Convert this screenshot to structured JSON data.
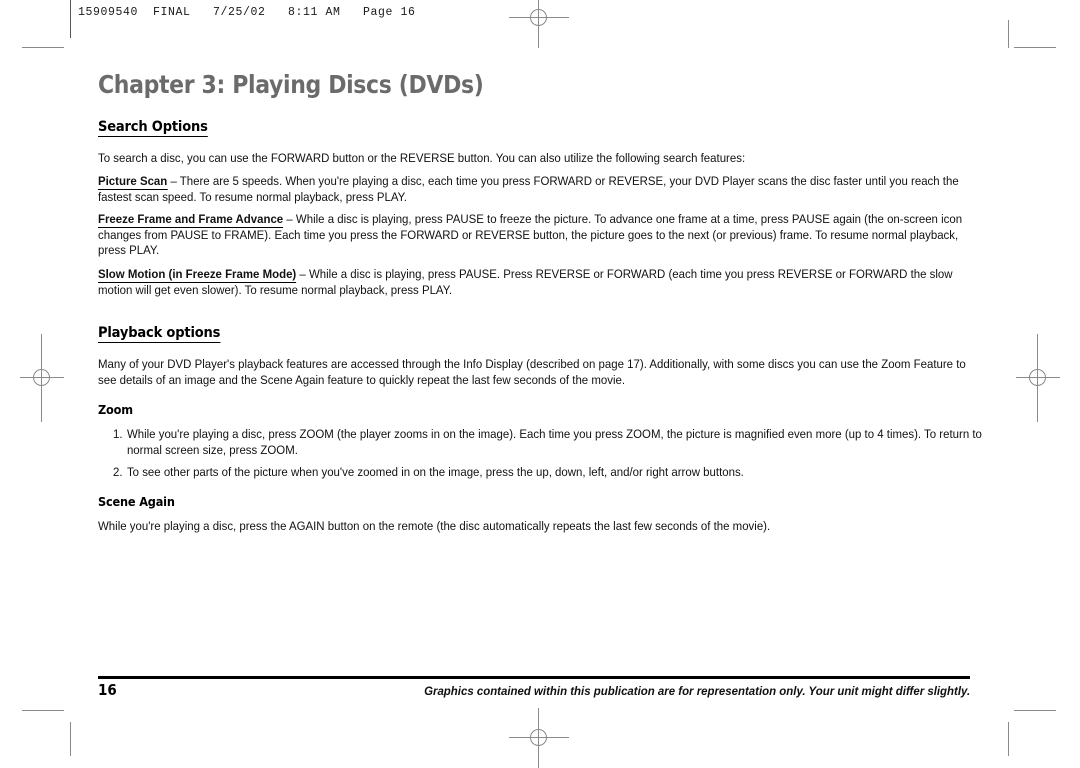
{
  "print_marks": {
    "header_slug": "15909540  FINAL   7/25/02   8:11 AM   Page 16",
    "registration_icon": "registration-target-icon"
  },
  "chapter": {
    "title": "Chapter 3: Playing Discs (DVDs)"
  },
  "sections": {
    "search_options": {
      "heading": "Search Options",
      "intro": "To search a disc, you can use the FORWARD button or the REVERSE button. You can also utilize the following search features:",
      "entries": [
        {
          "term": "Picture Scan",
          "dash": " – ",
          "body": "There are 5 speeds. When you're playing a disc, each time you press FORWARD or REVERSE, your DVD Player scans the disc faster until you reach the fastest scan speed. To resume normal playback, press PLAY."
        },
        {
          "term": "Freeze Frame and Frame Advance",
          "dash": " – ",
          "body": "While a disc is playing, press PAUSE to freeze the picture. To advance one frame at a time, press PAUSE again (the on-screen icon changes from PAUSE to FRAME). Each time you press the FORWARD or REVERSE button, the picture goes to the next (or previous) frame. To resume normal playback, press PLAY."
        },
        {
          "term": "Slow Motion (in Freeze Frame Mode)",
          "dash": " – ",
          "body": "While a disc is playing, press PAUSE. Press REVERSE or FORWARD (each time you press REVERSE or FORWARD the slow motion will get even slower). To resume normal playback, press PLAY."
        }
      ]
    },
    "playback_options": {
      "heading": "Playback options",
      "intro": "Many of your DVD Player's playback features are accessed through the Info Display (described on page 17). Additionally, with some discs you can use the Zoom Feature to see details of an image and the Scene Again feature to quickly repeat the last few seconds of the movie.",
      "zoom": {
        "heading": "Zoom",
        "steps": [
          {
            "number": "1.",
            "text": "While you're playing a disc, press ZOOM (the player zooms in on the image). Each time you press ZOOM, the picture is magnified even more (up to 4 times). To return to normal screen size, press ZOOM."
          },
          {
            "number": "2.",
            "text": "To see other parts of the picture when you've zoomed in on the image, press the up, down, left, and/or right arrow buttons."
          }
        ]
      },
      "scene_again": {
        "heading": "Scene Again",
        "body": "While you're playing a disc, press the AGAIN button on the remote (the disc automatically repeats the last few seconds of the movie)."
      }
    }
  },
  "footer": {
    "page_number": "16",
    "note": "Graphics contained within this publication are for representation only. Your unit might differ slightly."
  },
  "colors": {
    "chapter_title": "#6b6b6b",
    "body_text": "#111111",
    "crop_mark": "#8a8a8a"
  }
}
